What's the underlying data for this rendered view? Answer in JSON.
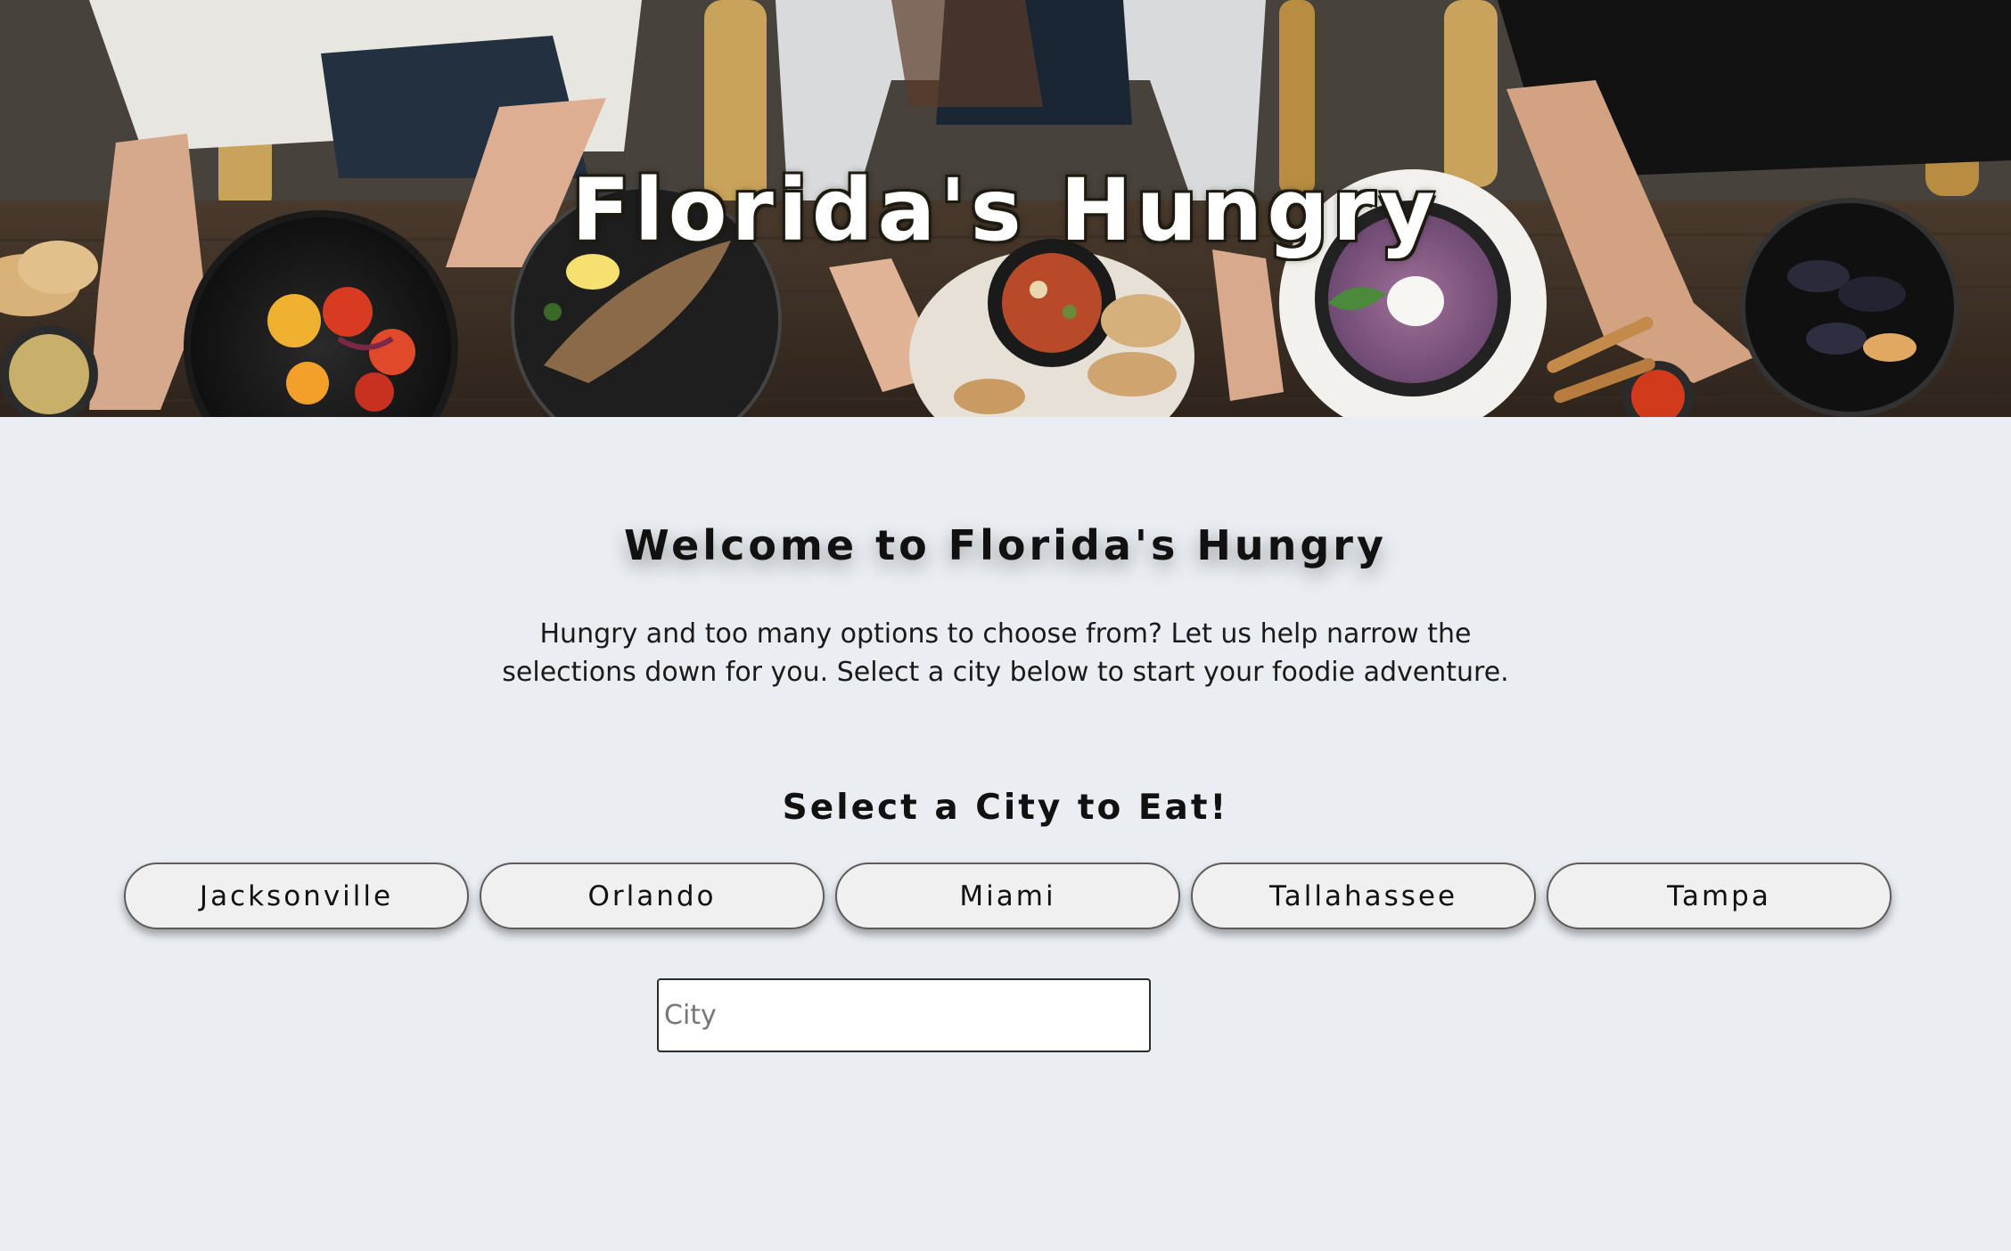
{
  "hero": {
    "title": "Florida's Hungry",
    "image_alt": "Overhead view of people sharing dishes at a restaurant table"
  },
  "intro": {
    "heading": "Welcome to Florida's Hungry",
    "text": "Hungry and too many options to choose from? Let us help narrow the selections down for you. Select a city below to start your foodie adventure."
  },
  "city_select": {
    "heading": "Select a City to Eat!",
    "cities": [
      "Jacksonville",
      "Orlando",
      "Miami",
      "Tallahassee",
      "Tampa"
    ],
    "input_placeholder": "City",
    "input_value": ""
  },
  "colors": {
    "page_background": "#eaeef2",
    "button_background": "#f0f0f0",
    "text": "#111111"
  }
}
